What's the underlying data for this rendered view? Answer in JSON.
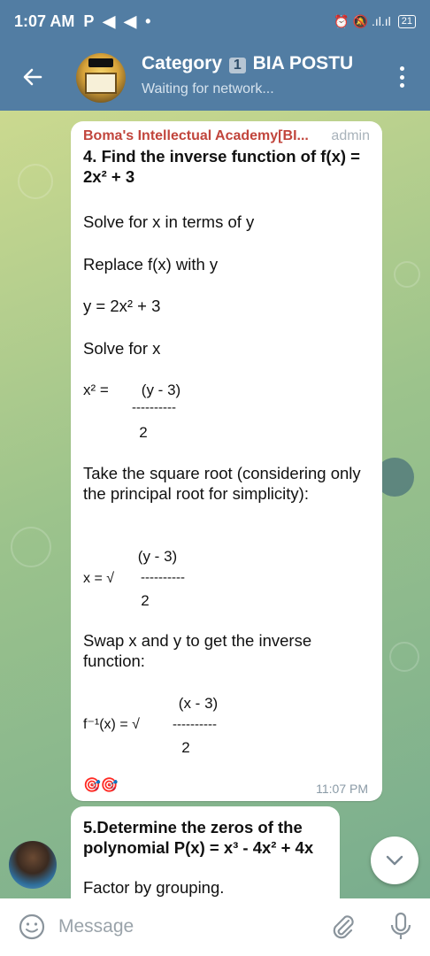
{
  "status_bar": {
    "time": "1:07 AM",
    "left_icons": [
      "P",
      "◀",
      "◀",
      "•"
    ],
    "right_icons": "⏰ 🔕 .ıl.ıl",
    "battery": "21"
  },
  "app_bar": {
    "title_prefix": "Category",
    "title_badge": "1",
    "title_suffix": "BIA POSTU",
    "subtitle": "Waiting for network...",
    "back_icon": "arrow-left-icon",
    "menu_icon": "more-vert-icon"
  },
  "message1": {
    "sender": "Boma's Intellectual Academy[BI...",
    "role": "admin",
    "question": "4. Find the inverse function of f(x) = 2x² + 3",
    "p1": "Solve for x in terms of y",
    "p2": "Replace f(x) with y",
    "p3": "y = 2x² + 3",
    "p4": "Solve for x",
    "eq1_lhs": "x² =",
    "eq1_num": "(y - 3)",
    "eq1_bar": "----------",
    "eq1_den": "2",
    "p5": "Take the square root (considering only the principal root for simplicity):",
    "eq2_lhs": "x = √",
    "eq2_num": "(y - 3)",
    "eq2_bar": "----------",
    "eq2_den": "2",
    "p6": "Swap x and y to get the inverse function:",
    "eq3_lhs": "f⁻¹(x) = √",
    "eq3_num": "(x - 3)",
    "eq3_bar": "----------",
    "eq3_den": "2",
    "reactions": "🎯🎯",
    "time": "11:07 PM"
  },
  "message2": {
    "question": "5.Determine the zeros of the polynomial P(x) = x³ - 4x² + 4x",
    "p1": "Factor by grouping."
  },
  "input": {
    "placeholder": "Message"
  },
  "colors": {
    "header": "#527da3",
    "sender": "#c1453c",
    "time": "#8a9aa6"
  }
}
